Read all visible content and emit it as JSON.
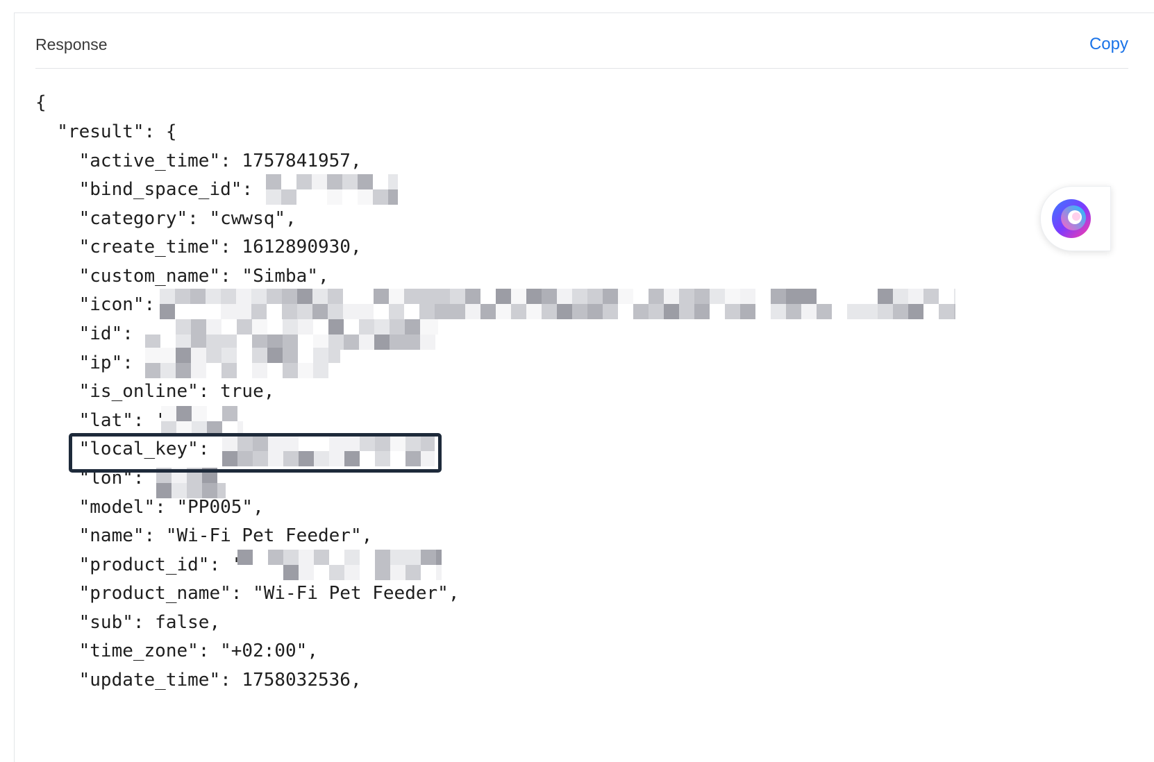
{
  "header": {
    "title": "Response",
    "copy_label": "Copy"
  },
  "code_lines": [
    "{",
    "  \"result\": {",
    "    \"active_time\": 1757841957,",
    "    \"bind_space_id\": ",
    "    \"category\": \"cwwsq\",",
    "    \"create_time\": 1612890930,",
    "    \"custom_name\": \"Simba\",",
    "    \"icon\": ",
    "    \"id\": ",
    "    \"ip\": ",
    "    \"is_online\": true,",
    "    \"lat\": '",
    "    \"local_key\": ",
    "    \"lon\": ",
    "    \"model\": \"PP005\",",
    "    \"name\": \"Wi-Fi Pet Feeder\",",
    "    \"product_id\": '",
    "    \"product_name\": \"Wi-Fi Pet Feeder\",",
    "    \"sub\": false,",
    "    \"time_zone\": \"+02:00\",",
    "    \"update_time\": 1758032536,"
  ],
  "colors": {
    "link": "#1a73e8",
    "highlight_border": "#1e2a3a",
    "redaction": "#c9cacf"
  },
  "icons": {
    "assistant": "assistant-swirl-icon"
  }
}
